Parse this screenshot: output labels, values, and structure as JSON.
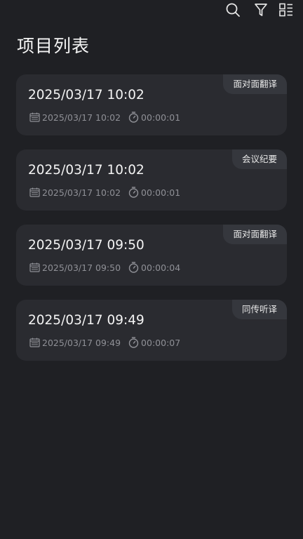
{
  "header": {
    "title": "项目列表"
  },
  "toolbar": {
    "icons": [
      "search-icon",
      "filter-icon",
      "grid-list-icon"
    ]
  },
  "projects": [
    {
      "title": "2025/03/17 10:02",
      "tag": "面对面翻译",
      "date": "2025/03/17 10:02",
      "duration": "00:00:01"
    },
    {
      "title": "2025/03/17 10:02",
      "tag": "会议纪要",
      "date": "2025/03/17 10:02",
      "duration": "00:00:01"
    },
    {
      "title": "2025/03/17 09:50",
      "tag": "面对面翻译",
      "date": "2025/03/17 09:50",
      "duration": "00:00:04"
    },
    {
      "title": "2025/03/17 09:49",
      "tag": "同传听译",
      "date": "2025/03/17 09:49",
      "duration": "00:00:07"
    }
  ],
  "colors": {
    "background": "#1f2024",
    "card": "#2a2b30",
    "tag_background": "#35373d",
    "meta_text": "#8f9096"
  }
}
